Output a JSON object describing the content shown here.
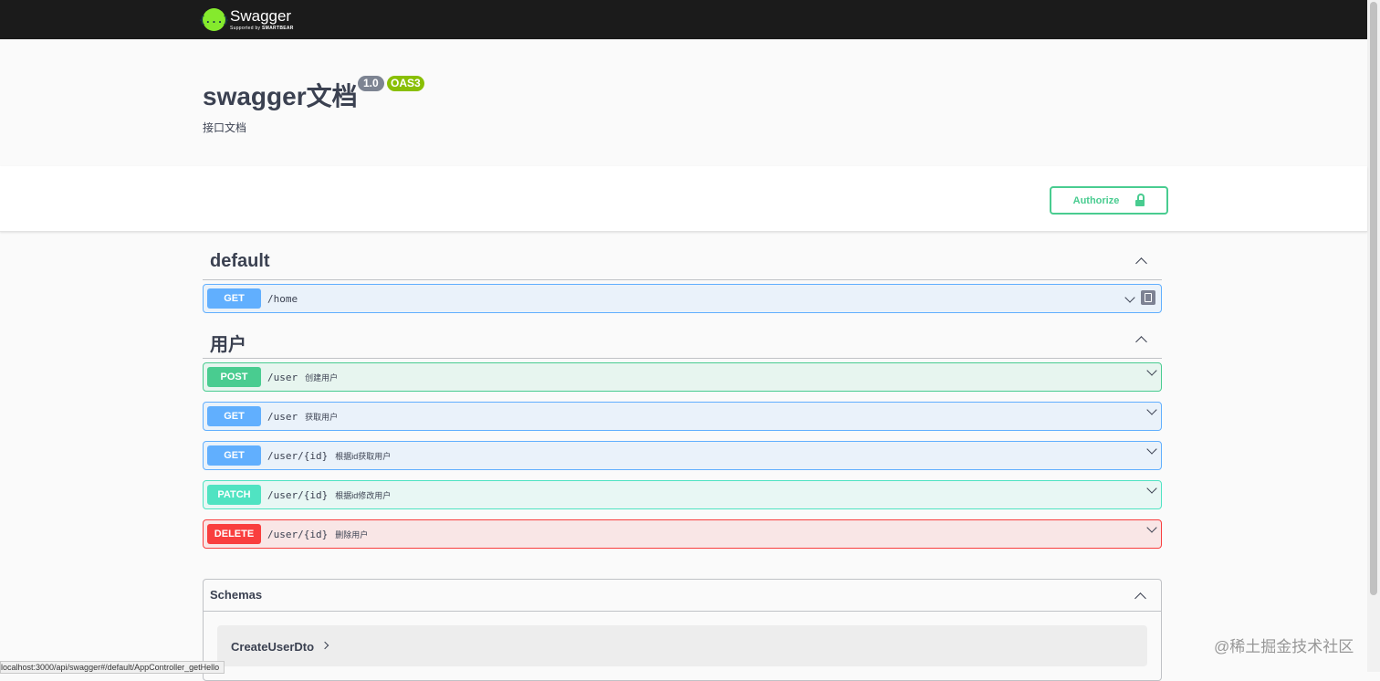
{
  "topbar": {
    "logo_glyph": "{...}",
    "logo_name": "Swagger",
    "logo_sub_prefix": "Supported by ",
    "logo_sub_brand": "SMARTBEAR"
  },
  "info": {
    "title": "swagger文档",
    "version": "1.0",
    "oas": "OAS3",
    "description": "接口文档"
  },
  "authorize": {
    "label": "Authorize",
    "icon": "lock-icon"
  },
  "tags": [
    {
      "name": "default",
      "operations": [
        {
          "method": "GET",
          "path": "/home",
          "summary": ""
        }
      ]
    },
    {
      "name": "用户",
      "operations": [
        {
          "method": "POST",
          "path": "/user",
          "summary": "创建用户"
        },
        {
          "method": "GET",
          "path": "/user",
          "summary": "获取用户"
        },
        {
          "method": "GET",
          "path": "/user/{id}",
          "summary": "根据id获取用户"
        },
        {
          "method": "PATCH",
          "path": "/user/{id}",
          "summary": "根据id修改用户"
        },
        {
          "method": "DELETE",
          "path": "/user/{id}",
          "summary": "删除用户"
        }
      ]
    }
  ],
  "schemas": {
    "title": "Schemas",
    "models": [
      "CreateUserDto"
    ]
  },
  "status_url": "localhost:3000/api/swagger#/default/AppController_getHello",
  "watermark": "@稀土掘金技术社区",
  "colors": {
    "get": "#61affe",
    "post": "#49cc90",
    "patch": "#50e3c2",
    "delete": "#f93e3e",
    "brand": "#85ea2d"
  }
}
